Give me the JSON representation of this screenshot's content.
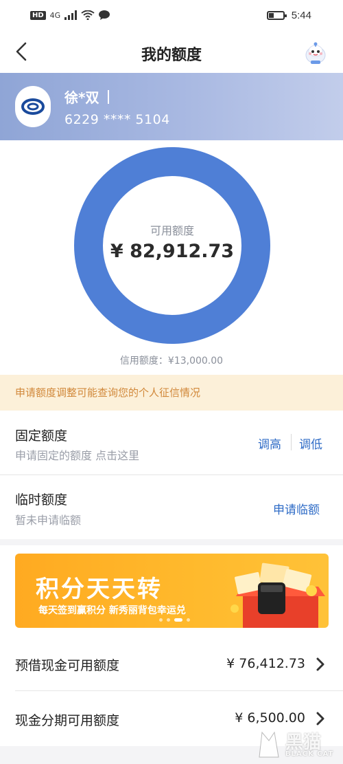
{
  "status_bar": {
    "hd": "HD",
    "signal": "4G",
    "time": "5:44"
  },
  "nav": {
    "title": "我的额度"
  },
  "card": {
    "holder_name": "徐*双",
    "card_number": "6229 **** 5104"
  },
  "quota": {
    "available_label": "可用额度",
    "available_amount": "¥ 82,912.73",
    "credit_limit_text": "信用额度：¥13,000.00",
    "donut_color": "#4f7fd6"
  },
  "notice": {
    "text": "申请额度调整可能查询您的个人征信情况"
  },
  "fixed_quota": {
    "title": "固定额度",
    "subtitle": "申请固定的额度 点击这里",
    "raise_label": "调高",
    "lower_label": "调低"
  },
  "temp_quota": {
    "title": "临时额度",
    "subtitle": "暂未申请临额",
    "apply_label": "申请临额"
  },
  "banner": {
    "title": "积分天天转",
    "subtitle": "每天签到赢积分 新秀丽背包幸运兑"
  },
  "cash_rows": [
    {
      "label": "预借现金可用额度",
      "amount": "¥ 76,412.73"
    },
    {
      "label": "现金分期可用额度",
      "amount": "¥ 6,500.00"
    }
  ],
  "watermark": {
    "brand": "黑猫",
    "brand_en": "BLACK CAT"
  },
  "colors": {
    "accent": "#2e6bc6",
    "notice_text": "#d1883a",
    "notice_bg": "#fcf0d9"
  }
}
